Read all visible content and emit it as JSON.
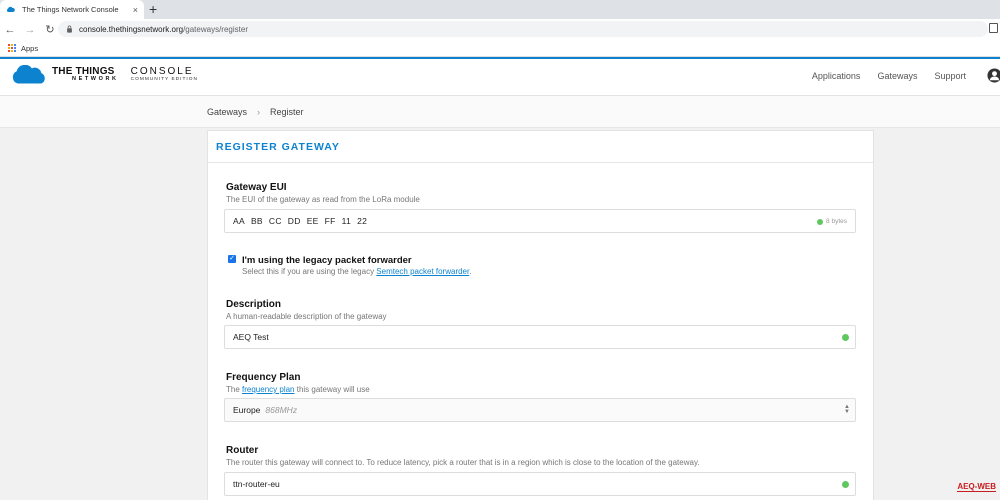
{
  "browser": {
    "tab_title": "The Things Network Console",
    "tab_close": "×",
    "new_tab": "+",
    "url_host": "console.thethingsnetwork.org",
    "url_path": "/gateways/register",
    "bookmark_apps": "Apps"
  },
  "header": {
    "brand_line1": "THE THINGS",
    "brand_line2": "NETWORK",
    "console_line1": "CONSOLE",
    "console_line2": "COMMUNITY EDITION",
    "nav": [
      "Applications",
      "Gateways",
      "Support"
    ],
    "accent": "#0d83d0"
  },
  "breadcrumb": {
    "items": [
      "Gateways",
      "Register"
    ],
    "separator": "›"
  },
  "card": {
    "title": "REGISTER GATEWAY",
    "eui": {
      "label": "Gateway EUI",
      "help": "The EUI of the gateway as read from the LoRa module",
      "bytes": [
        "AA",
        "BB",
        "CC",
        "DD",
        "EE",
        "FF",
        "11",
        "22"
      ],
      "byte_count": "8 bytes"
    },
    "legacy": {
      "checked": true,
      "label": "I'm using the legacy packet forwarder",
      "help_prefix": "Select this if you are using the legacy ",
      "help_link": "Semtech packet forwarder",
      "help_suffix": "."
    },
    "description": {
      "label": "Description",
      "help": "A human-readable description of the gateway",
      "value": "AEQ Test"
    },
    "frequency": {
      "label": "Frequency Plan",
      "help_prefix": "The ",
      "help_link": "frequency plan",
      "help_suffix": " this gateway will use",
      "value": "Europe",
      "value_extra": "868MHz"
    },
    "router": {
      "label": "Router",
      "help": "The router this gateway will connect to. To reduce latency, pick a router that is in a region which is close to the location of the gateway.",
      "value": "ttn-router-eu"
    }
  },
  "watermark": "AEQ-WEB"
}
